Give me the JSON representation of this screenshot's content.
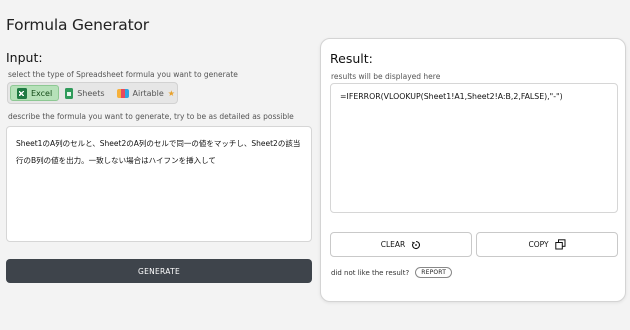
{
  "app": {
    "title": "Formula Generator"
  },
  "input": {
    "heading": "Input:",
    "type_hint": "select the type of Spreadsheet formula you want to generate",
    "types": [
      {
        "label": "Excel",
        "icon": "excel-icon",
        "selected": true
      },
      {
        "label": "Sheets",
        "icon": "sheets-icon",
        "selected": false
      },
      {
        "label": "Airtable",
        "icon": "airtable-icon",
        "selected": false,
        "badge": "star-icon"
      }
    ],
    "describe_hint": "describe the formula you want to generate, try to be as detailed as possible",
    "description": "Sheet1のA列のセルと、Sheet2のA列のセルで同一の値をマッチし、Sheet2の該当行のB列の値を出力。一致しない場合はハイフンを挿入して",
    "generate_label": "GENERATE"
  },
  "result": {
    "heading": "Result:",
    "hint": "results will be displayed here",
    "formula": "=IFERROR(VLOOKUP(Sheet1!A1,Sheet2!A:B,2,FALSE),\"-\")",
    "clear_label": "CLEAR",
    "copy_label": "COPY",
    "feedback_text": "did not like the result?",
    "report_label": "REPORT"
  },
  "colors": {
    "background": "#f3f3f3",
    "selected_type_bg": "#b6e1b9",
    "generate_bg": "#3e444b"
  }
}
